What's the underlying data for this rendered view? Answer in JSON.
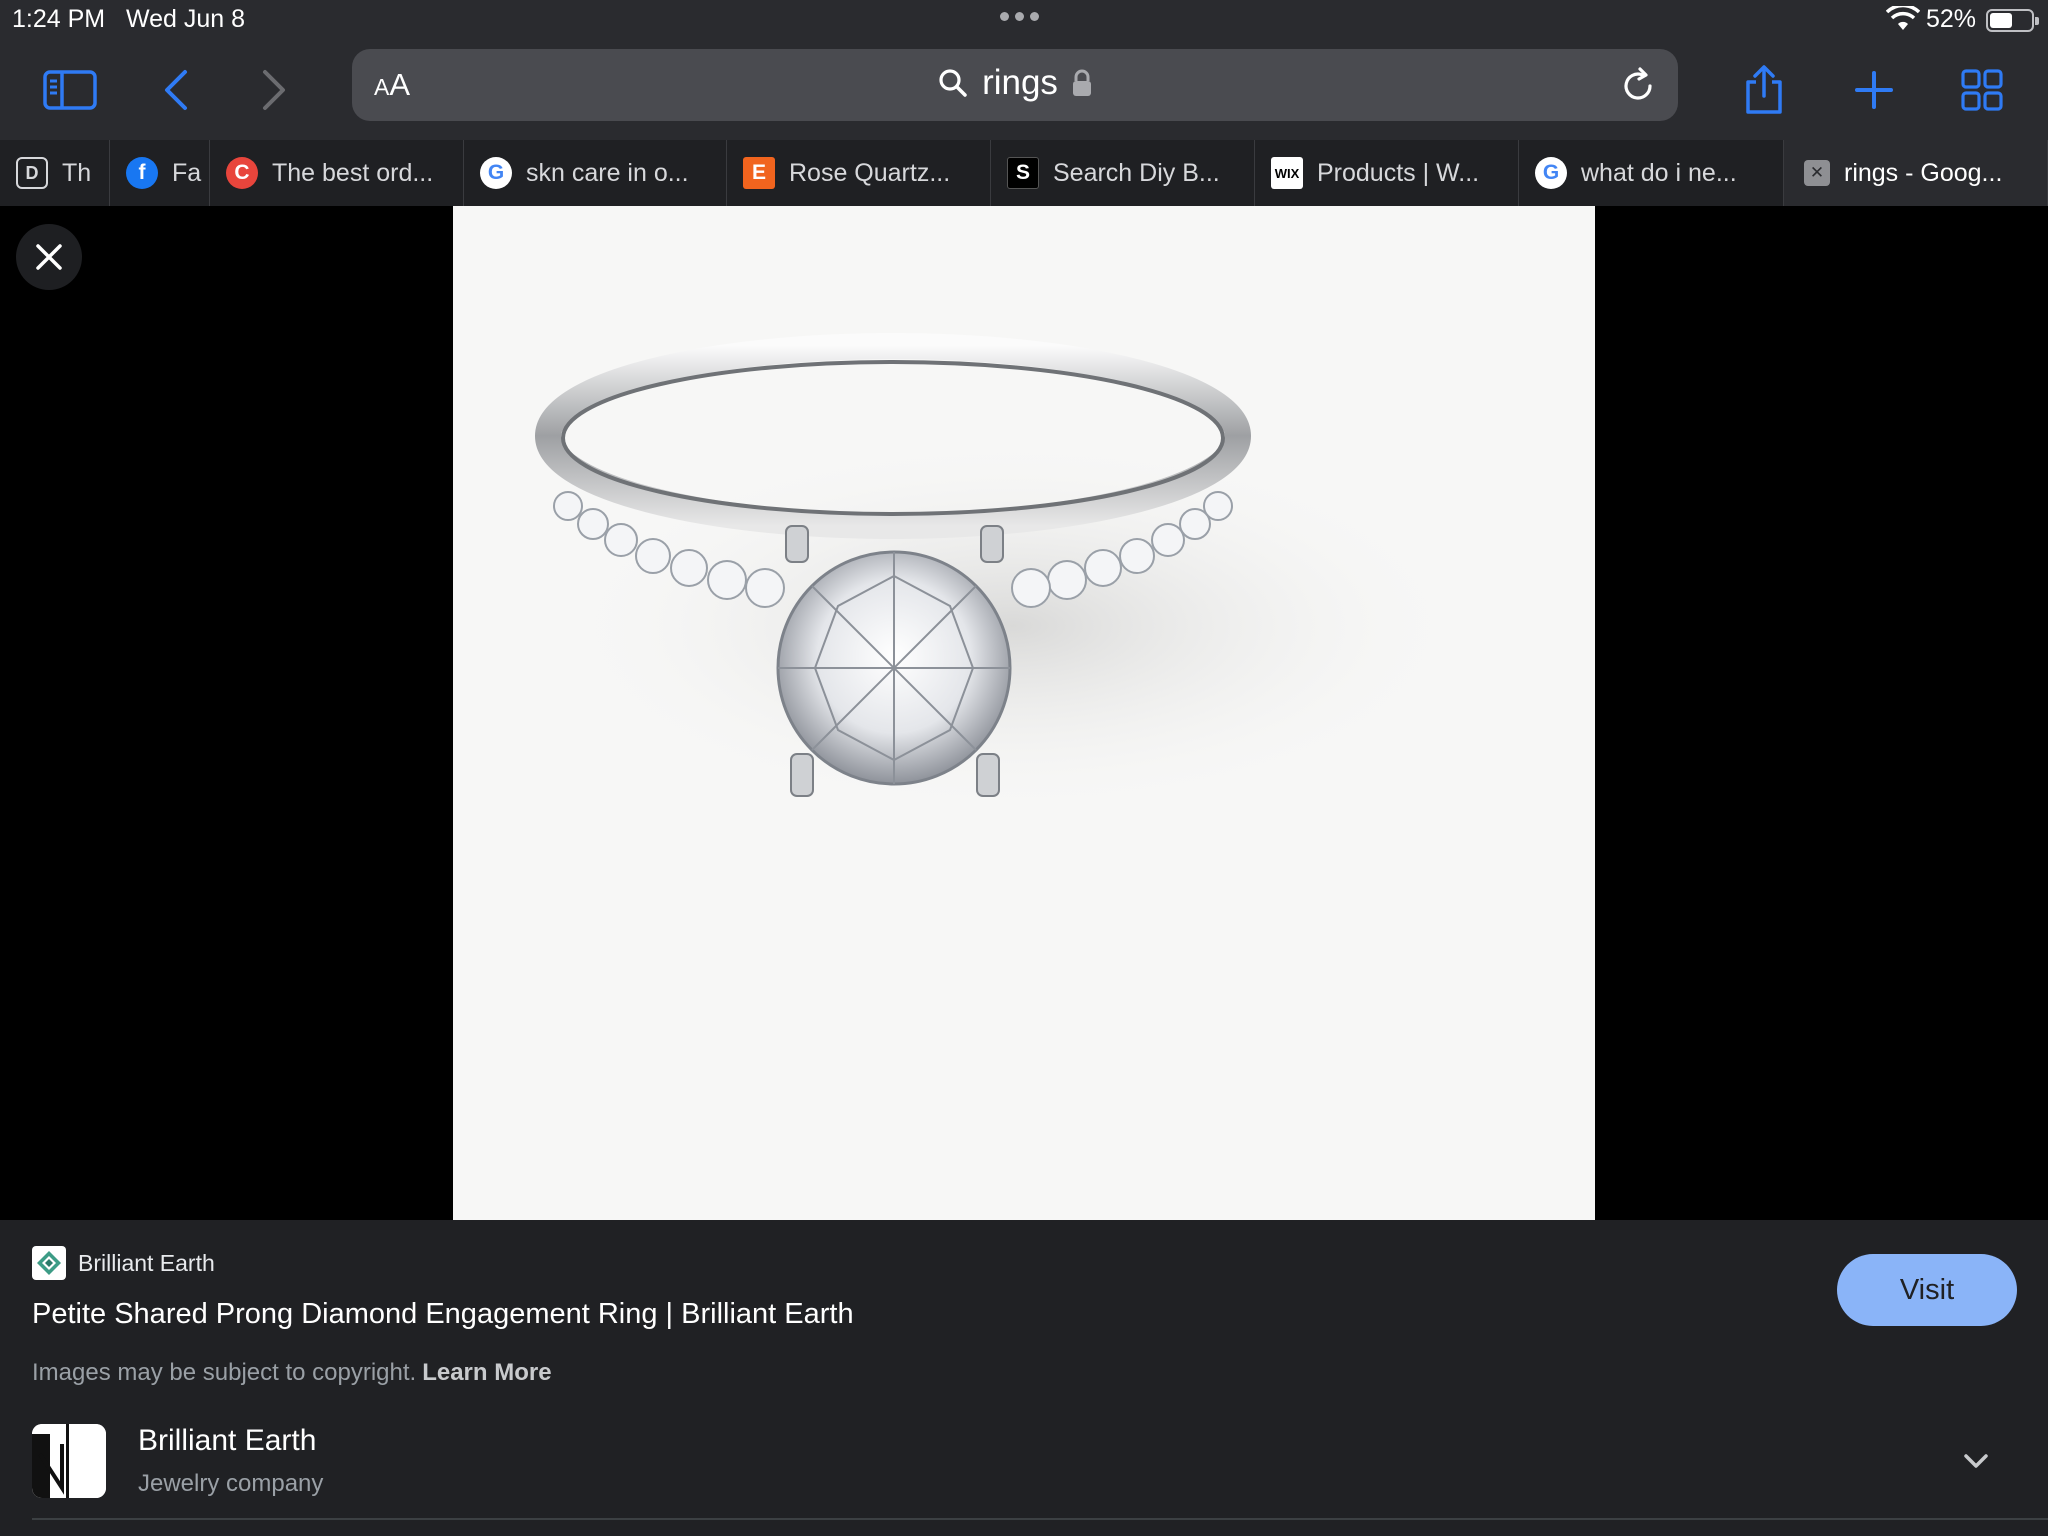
{
  "status": {
    "time": "1:24 PM",
    "date": "Wed Jun 8",
    "battery": "52%"
  },
  "toolbar": {
    "aa_small": "A",
    "aa_large": "A",
    "query": "rings"
  },
  "tabs": [
    {
      "label": "Th",
      "favicon": "D"
    },
    {
      "label": "Fa",
      "favicon": "f"
    },
    {
      "label": "The best ord...",
      "favicon": "C"
    },
    {
      "label": "skn care in o...",
      "favicon": "G"
    },
    {
      "label": "Rose Quartz...",
      "favicon": "E"
    },
    {
      "label": "Search Diy B...",
      "favicon": "S"
    },
    {
      "label": "Products | W...",
      "favicon": "WIX"
    },
    {
      "label": "what do i ne...",
      "favicon": "G"
    },
    {
      "label": "rings - Goog...",
      "favicon": "✕"
    }
  ],
  "info": {
    "source_name": "Brilliant Earth",
    "title": "Petite Shared Prong Diamond Engagement Ring | Brilliant Earth",
    "copyright": "Images may be subject to copyright.",
    "learn_more": "Learn More",
    "visit": "Visit",
    "entity_name": "Brilliant Earth",
    "entity_type": "Jewelry company"
  },
  "colors": {
    "accent": "#2f7bf5",
    "visit_bg": "#8ab4f8",
    "panel_bg": "#202124"
  }
}
